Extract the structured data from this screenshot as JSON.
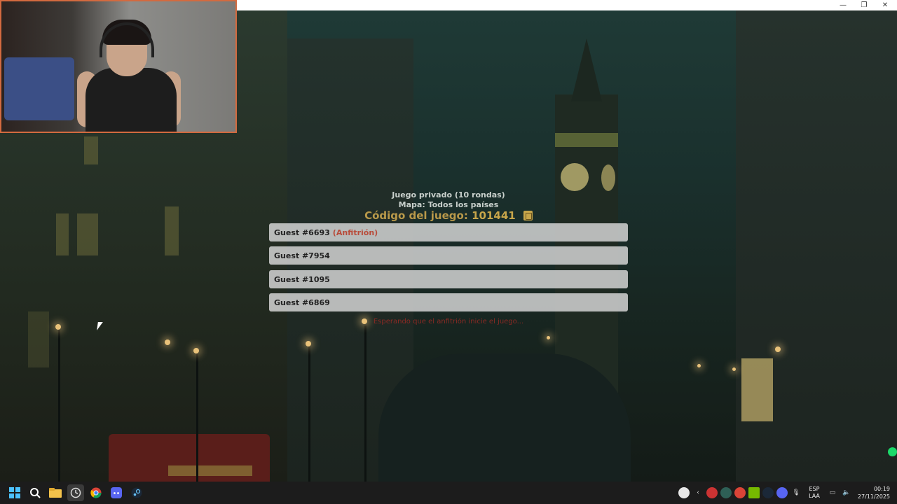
{
  "window": {
    "minimize_glyph": "—",
    "maximize_glyph": "❐",
    "close_glyph": "✕"
  },
  "lobby": {
    "game_type": "Juego privado (10 rondas)",
    "map": "Mapa: Todos los países",
    "code_label": "Código del juego:",
    "code_value": "101441",
    "players": [
      {
        "name": "Guest #6693",
        "tag": "(Anfitrión)"
      },
      {
        "name": "Guest #7954",
        "tag": ""
      },
      {
        "name": "Guest #1095",
        "tag": ""
      },
      {
        "name": "Guest #6869",
        "tag": ""
      }
    ],
    "wait_message": "Esperando que el anfitrión inicie el juego..."
  },
  "taskbar": {
    "items": [
      "windows-start-icon",
      "search-icon",
      "file-explorer-icon",
      "clock-app-icon",
      "chrome-icon",
      "discord-icon",
      "steam-icon"
    ],
    "language": "ESP",
    "language_sub": "LAA",
    "time": "00:19",
    "date": "27/11/2025"
  },
  "colors": {
    "accent_gold": "#c7a54a",
    "host_red": "#b84b3a",
    "webcam_border": "#d36a3f",
    "status_green": "#1bd96a"
  }
}
